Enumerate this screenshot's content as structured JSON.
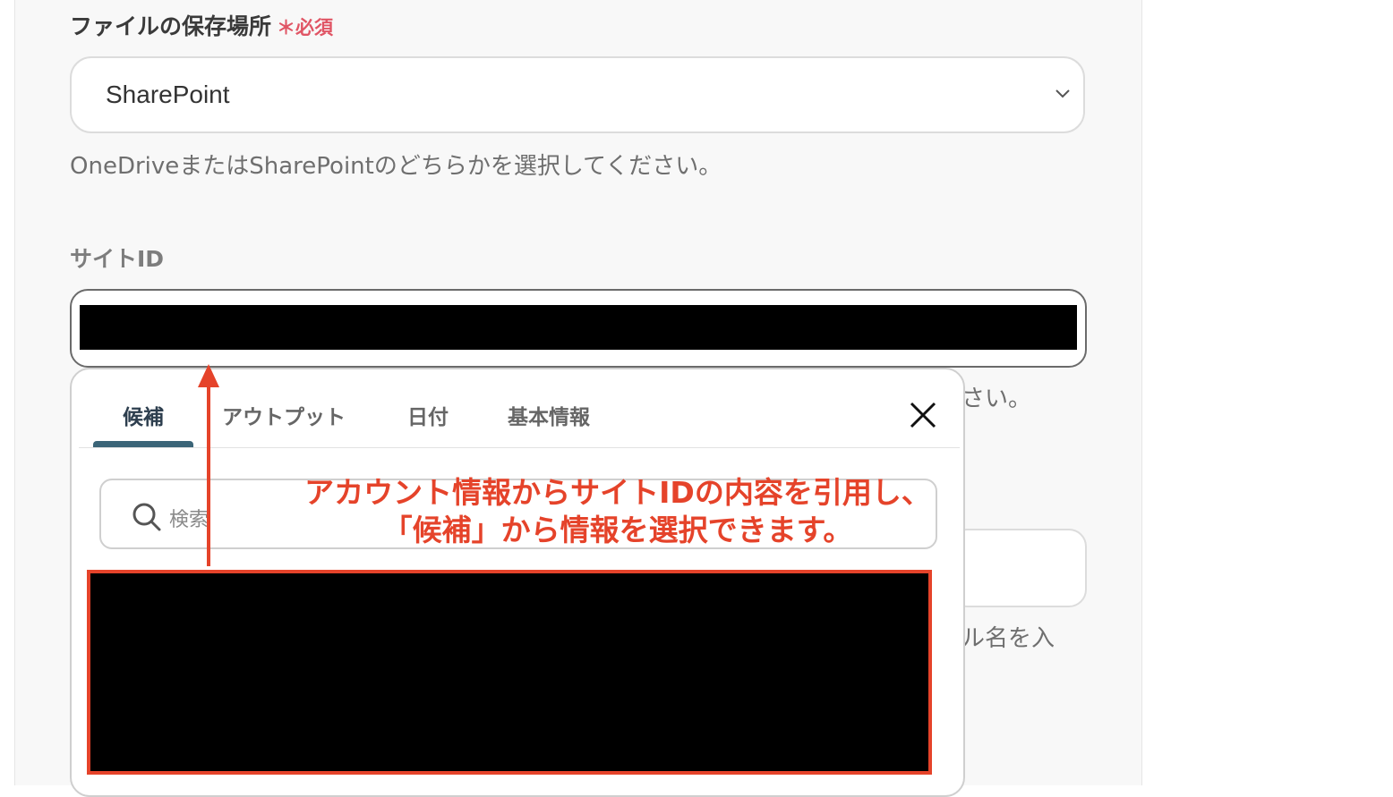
{
  "form": {
    "storage_label": "ファイルの保存場所",
    "required_badge": "＊必須",
    "storage_select_value": "SharePoint",
    "storage_help": "OneDriveまたはSharePointのどちらかを選択してください。",
    "site_id_label": "サイトID",
    "site_id_help_tail": "さい。",
    "file_name_help_tail": "ル名を入"
  },
  "popup": {
    "tabs": [
      {
        "label": "候補",
        "active": true
      },
      {
        "label": "アウトプット",
        "active": false
      },
      {
        "label": "日付",
        "active": false
      },
      {
        "label": "基本情報",
        "active": false
      }
    ],
    "search_placeholder": "検索"
  },
  "annotation": {
    "line1": "アカウント情報からサイトIDの内容を引用し、",
    "line2": "「候補」から情報を選択できます。"
  },
  "icons": [
    "chevron-down-icon",
    "close-icon",
    "search-icon",
    "arrow-up-icon"
  ],
  "colors": {
    "required": "#e05565",
    "annotation": "#e5432a",
    "active_tab": "#3b6578"
  }
}
